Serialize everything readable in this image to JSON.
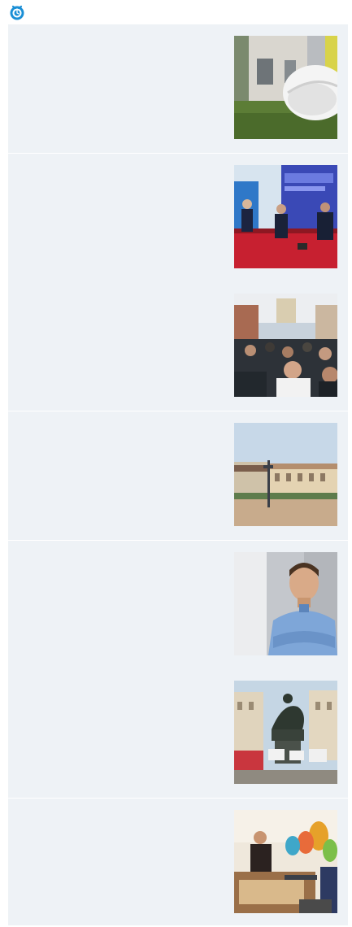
{
  "site": {
    "logo_icon": "blue-clock-logo-icon"
  },
  "feed": {
    "articles": [
      {
        "thumbnail_icon": "hard-hat-building-photo-icon"
      },
      {
        "thumbnail_icon": "conference-stage-panel-photo-icon"
      },
      {
        "thumbnail_icon": "crowd-in-square-photo-icon"
      },
      {
        "thumbnail_icon": "city-square-palace-photo-icon"
      },
      {
        "thumbnail_icon": "smiling-man-portrait-photo-icon"
      },
      {
        "thumbnail_icon": "equestrian-statue-photo-icon"
      },
      {
        "thumbnail_icon": "workshop-table-photo-icon"
      }
    ]
  },
  "colors": {
    "feed_background": "#eef2f6",
    "divider": "#ffffff",
    "brand": "#1a8fd6"
  }
}
